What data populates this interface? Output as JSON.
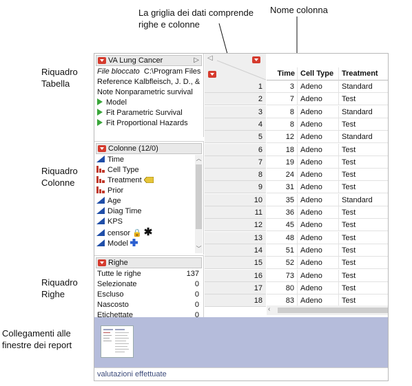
{
  "callouts": {
    "grid": "La griglia dei dati comprende righe e colonne",
    "column_name": "Nome colonna",
    "table_panel": "Riquadro Tabella",
    "columns_panel": "Riquadro Colonne",
    "rows_panel": "Riquadro Righe",
    "report_links": "Collegamenti alle finestre dei report"
  },
  "table_panel": {
    "title": "VA Lung Cancer",
    "file_label": "File bloccato",
    "file_value": "C:\\Program Files",
    "reference": "Reference  Kalbfleisch, J. D., &",
    "note": "Note  Nonparametric survival",
    "scripts": [
      "Model",
      "Fit Parametric Survival",
      "Fit Proportional Hazards"
    ]
  },
  "columns_panel": {
    "title": "Colonne (12/0)",
    "items": [
      {
        "name": "Time",
        "type": "continuous"
      },
      {
        "name": "Cell Type",
        "type": "nominal"
      },
      {
        "name": "Treatment",
        "type": "nominal",
        "badge": "label"
      },
      {
        "name": "Prior",
        "type": "nominal"
      },
      {
        "name": "Age",
        "type": "continuous"
      },
      {
        "name": "Diag Time",
        "type": "continuous"
      },
      {
        "name": "KPS",
        "type": "continuous"
      },
      {
        "name": "censor",
        "type": "continuous",
        "badge": "lock-star"
      },
      {
        "name": "Model",
        "type": "continuous",
        "badge": "plus"
      }
    ]
  },
  "rows_panel": {
    "title": "Righe",
    "items": [
      {
        "label": "Tutte le righe",
        "value": "137"
      },
      {
        "label": "Selezionate",
        "value": "0"
      },
      {
        "label": "Escluso",
        "value": "0"
      },
      {
        "label": "Nascosto",
        "value": "0"
      },
      {
        "label": "Etichettate",
        "value": "0"
      }
    ]
  },
  "grid": {
    "headers": [
      "Time",
      "Cell Type",
      "Treatment"
    ],
    "rows": [
      {
        "n": "1",
        "time": "3",
        "cell": "Adeno",
        "treat": "Standard"
      },
      {
        "n": "2",
        "time": "7",
        "cell": "Adeno",
        "treat": "Test"
      },
      {
        "n": "3",
        "time": "8",
        "cell": "Adeno",
        "treat": "Standard"
      },
      {
        "n": "4",
        "time": "8",
        "cell": "Adeno",
        "treat": "Test"
      },
      {
        "n": "5",
        "time": "12",
        "cell": "Adeno",
        "treat": "Standard"
      },
      {
        "n": "6",
        "time": "18",
        "cell": "Adeno",
        "treat": "Test"
      },
      {
        "n": "7",
        "time": "19",
        "cell": "Adeno",
        "treat": "Test"
      },
      {
        "n": "8",
        "time": "24",
        "cell": "Adeno",
        "treat": "Test"
      },
      {
        "n": "9",
        "time": "31",
        "cell": "Adeno",
        "treat": "Test"
      },
      {
        "n": "10",
        "time": "35",
        "cell": "Adeno",
        "treat": "Standard"
      },
      {
        "n": "11",
        "time": "36",
        "cell": "Adeno",
        "treat": "Test"
      },
      {
        "n": "12",
        "time": "45",
        "cell": "Adeno",
        "treat": "Test"
      },
      {
        "n": "13",
        "time": "48",
        "cell": "Adeno",
        "treat": "Test"
      },
      {
        "n": "14",
        "time": "51",
        "cell": "Adeno",
        "treat": "Test"
      },
      {
        "n": "15",
        "time": "52",
        "cell": "Adeno",
        "treat": "Test"
      },
      {
        "n": "16",
        "time": "73",
        "cell": "Adeno",
        "treat": "Test"
      },
      {
        "n": "17",
        "time": "80",
        "cell": "Adeno",
        "treat": "Test"
      },
      {
        "n": "18",
        "time": "83",
        "cell": "Adeno",
        "treat": "Test"
      }
    ]
  },
  "status_text": "valutazioni effettuate",
  "colors": {
    "red_menu": "#d53b2e",
    "continuous_icon": "#1f4ea8",
    "nominal_icon": "#c0392b",
    "script_green": "#3aa63a",
    "report_bg": "#b5bcdb"
  }
}
